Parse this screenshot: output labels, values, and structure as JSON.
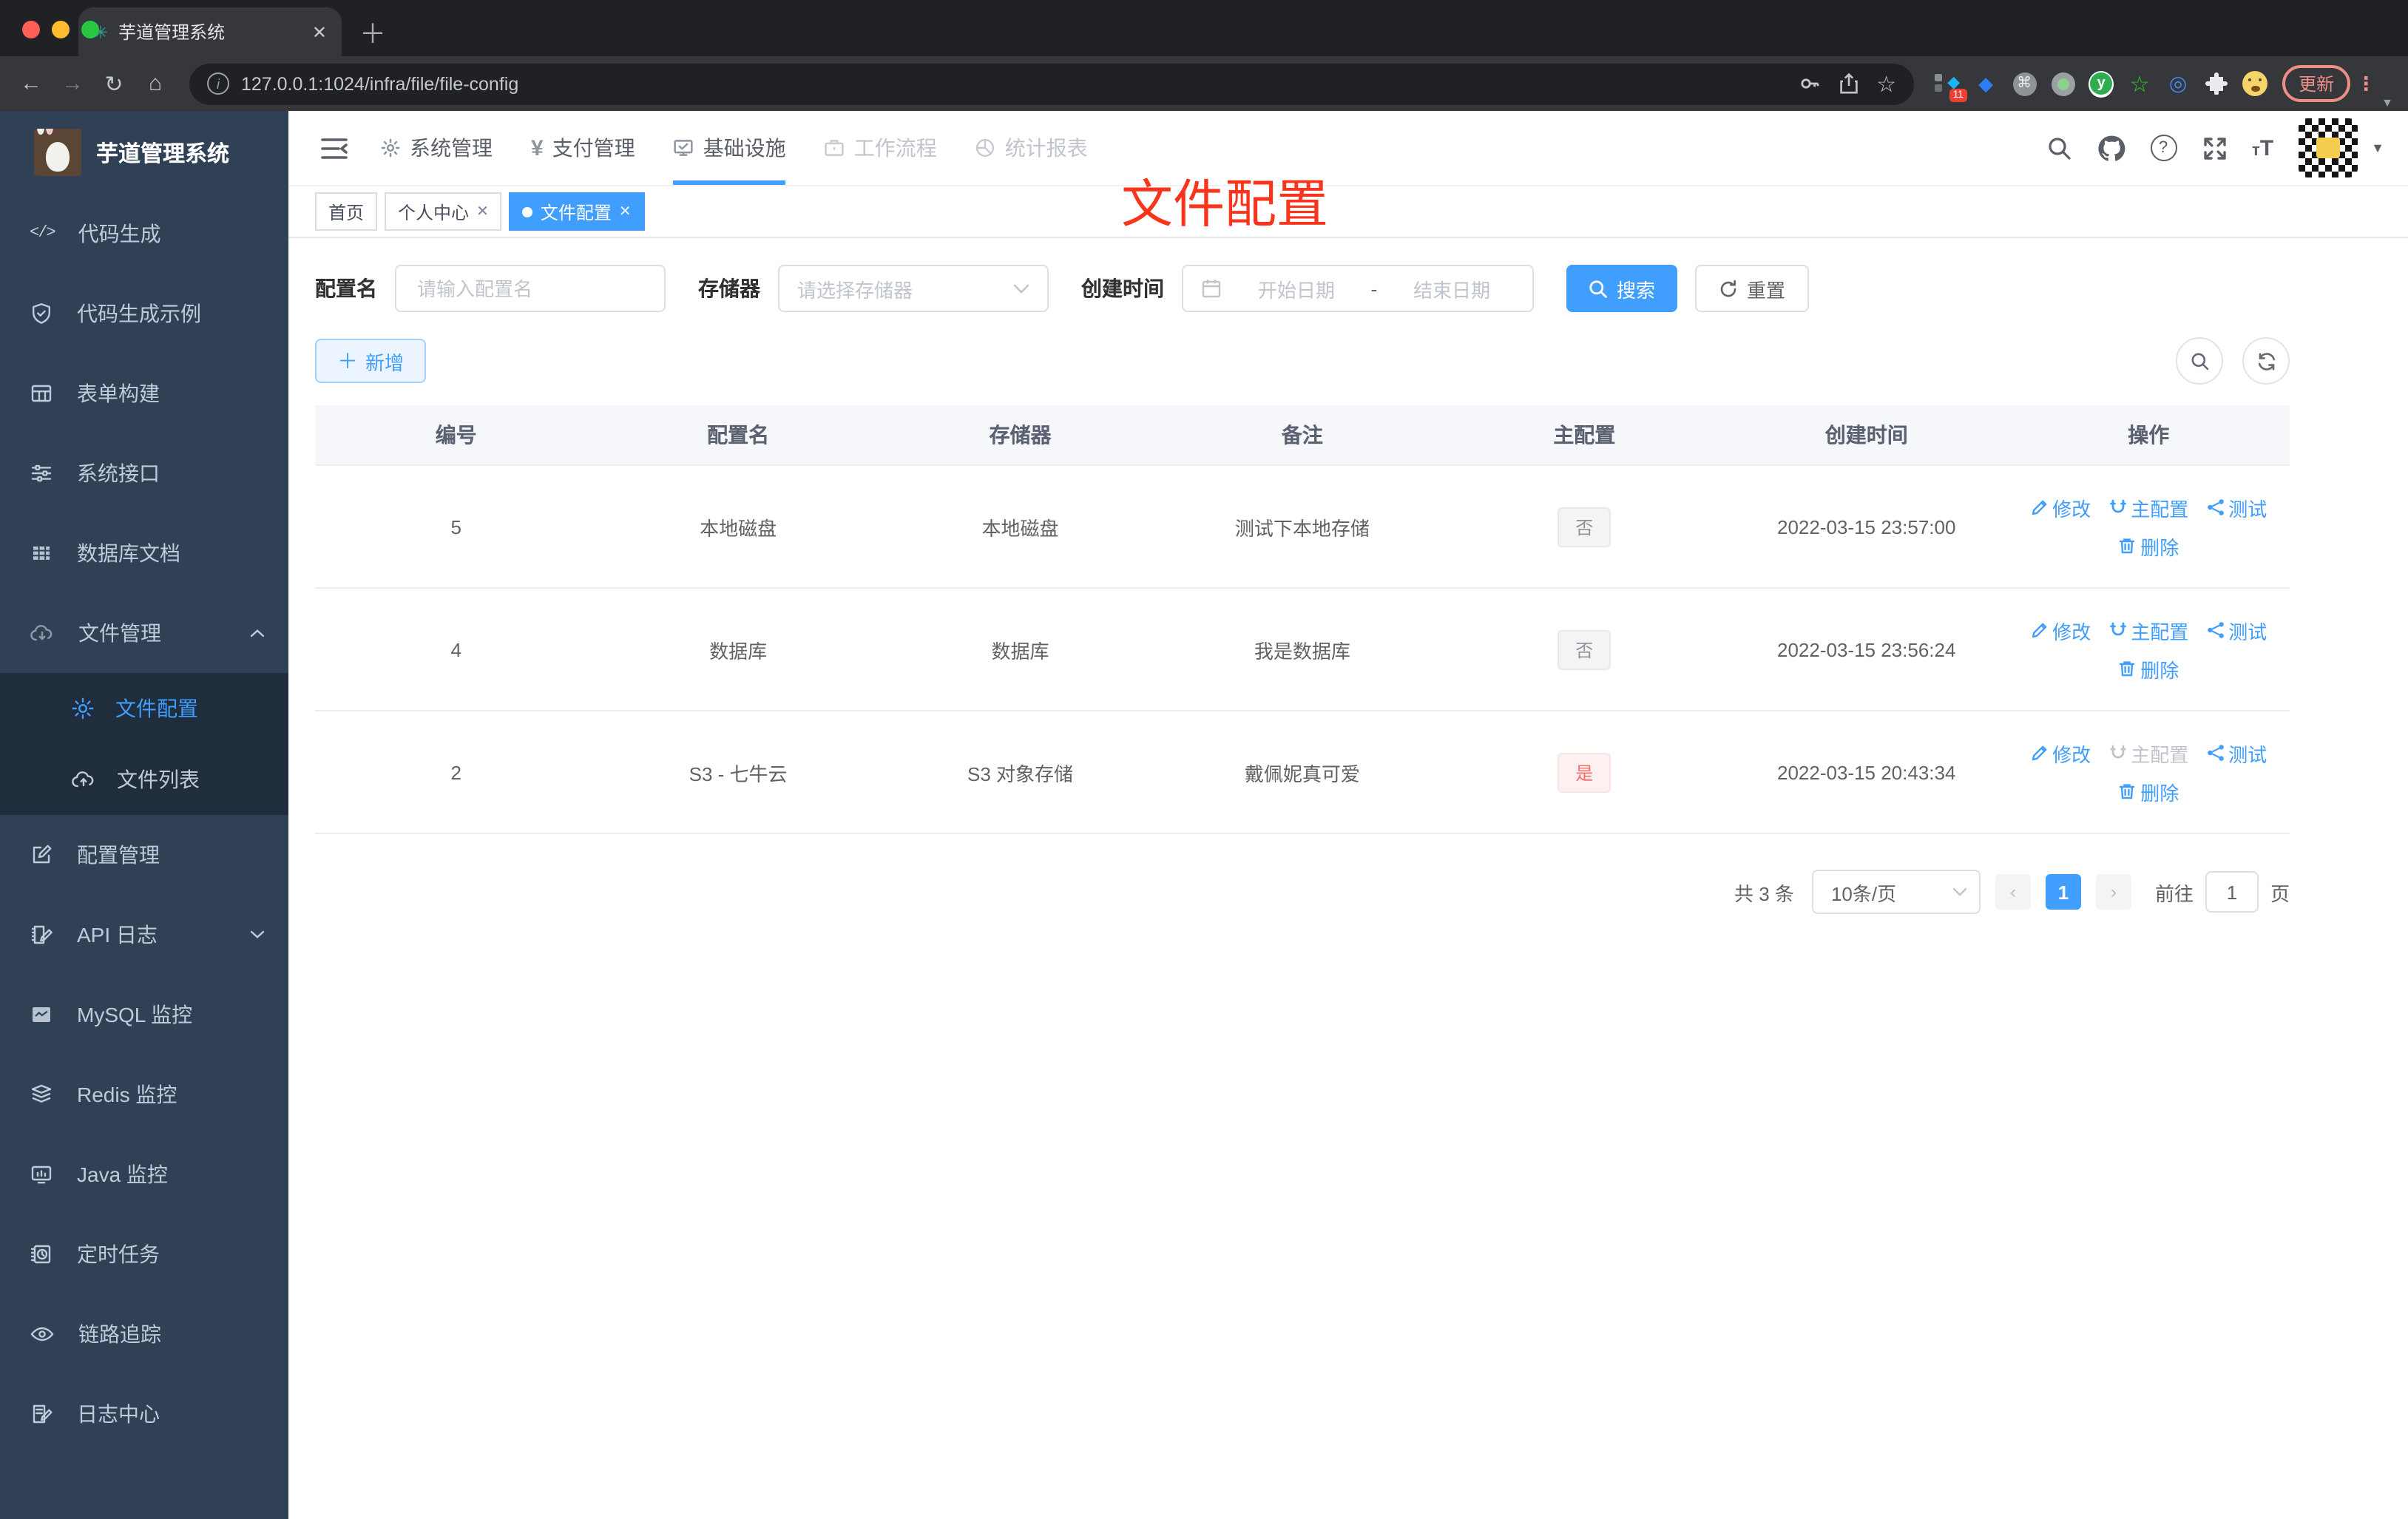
{
  "browser": {
    "tab_title": "芋道管理系统",
    "url": "127.0.0.1:1024/infra/file/file-config",
    "update_label": "更新",
    "extensions_badge": "11"
  },
  "overlay_title": "文件配置",
  "sidebar": {
    "title": "芋道管理系统",
    "items": [
      {
        "label": "代码生成",
        "icon": "code-icon"
      },
      {
        "label": "代码生成示例",
        "icon": "shield-check-icon"
      },
      {
        "label": "表单构建",
        "icon": "form-table-icon"
      },
      {
        "label": "系统接口",
        "icon": "sliders-icon"
      },
      {
        "label": "数据库文档",
        "icon": "database-grid-icon"
      },
      {
        "label": "文件管理",
        "icon": "cloud-download-icon"
      },
      {
        "label": "文件配置",
        "icon": "gear-icon",
        "active": true
      },
      {
        "label": "文件列表",
        "icon": "cloud-upload-icon"
      },
      {
        "label": "配置管理",
        "icon": "edit-square-icon"
      },
      {
        "label": "API 日志",
        "icon": "doc-pencil-icon"
      },
      {
        "label": "MySQL 监控",
        "icon": "chart-box-icon"
      },
      {
        "label": "Redis 监控",
        "icon": "layers-icon"
      },
      {
        "label": "Java 监控",
        "icon": "monitor-icon"
      },
      {
        "label": "定时任务",
        "icon": "schedule-icon"
      },
      {
        "label": "链路追踪",
        "icon": "eye-icon"
      },
      {
        "label": "日志中心",
        "icon": "log-doc-icon"
      }
    ]
  },
  "topnav": {
    "items": [
      {
        "label": "系统管理",
        "icon": "gear-icon"
      },
      {
        "label": "支付管理",
        "icon": "yen-icon"
      },
      {
        "label": "基础设施",
        "icon": "monitor-check-icon",
        "active": true
      },
      {
        "label": "工作流程",
        "icon": "briefcase-icon"
      },
      {
        "label": "统计报表",
        "icon": "chart-pie-icon"
      }
    ]
  },
  "tags": {
    "items": [
      {
        "label": "首页"
      },
      {
        "label": "个人中心",
        "closable": true
      },
      {
        "label": "文件配置",
        "closable": true,
        "active": true
      }
    ]
  },
  "filters": {
    "config_name_label": "配置名",
    "config_name_placeholder": "请输入配置名",
    "storage_label": "存储器",
    "storage_placeholder": "请选择存储器",
    "create_time_label": "创建时间",
    "date_start_placeholder": "开始日期",
    "date_separator": "-",
    "date_end_placeholder": "结束日期",
    "search_label": "搜索",
    "reset_label": "重置"
  },
  "toolbar": {
    "add_label": "新增"
  },
  "table": {
    "columns": [
      "编号",
      "配置名",
      "存储器",
      "备注",
      "主配置",
      "创建时间",
      "操作"
    ],
    "actions": {
      "edit": "修改",
      "master": "主配置",
      "test": "测试",
      "delete": "删除"
    },
    "rows": [
      {
        "id": "5",
        "name": "本地磁盘",
        "storage": "本地磁盘",
        "remark": "测试下本地存储",
        "master": "否",
        "master_danger": false,
        "master_link_disabled": false,
        "created": "2022-03-15 23:57:00"
      },
      {
        "id": "4",
        "name": "数据库",
        "storage": "数据库",
        "remark": "我是数据库",
        "master": "否",
        "master_danger": false,
        "master_link_disabled": false,
        "created": "2022-03-15 23:56:24"
      },
      {
        "id": "2",
        "name": "S3 - 七牛云",
        "storage": "S3 对象存储",
        "remark": "戴佩妮真可爱",
        "master": "是",
        "master_danger": true,
        "master_link_disabled": true,
        "created": "2022-03-15 20:43:34"
      }
    ]
  },
  "pagination": {
    "total": "共 3 条",
    "page_size": "10条/页",
    "current": "1",
    "goto_label": "前往",
    "goto_value": "1",
    "unit_label": "页"
  }
}
